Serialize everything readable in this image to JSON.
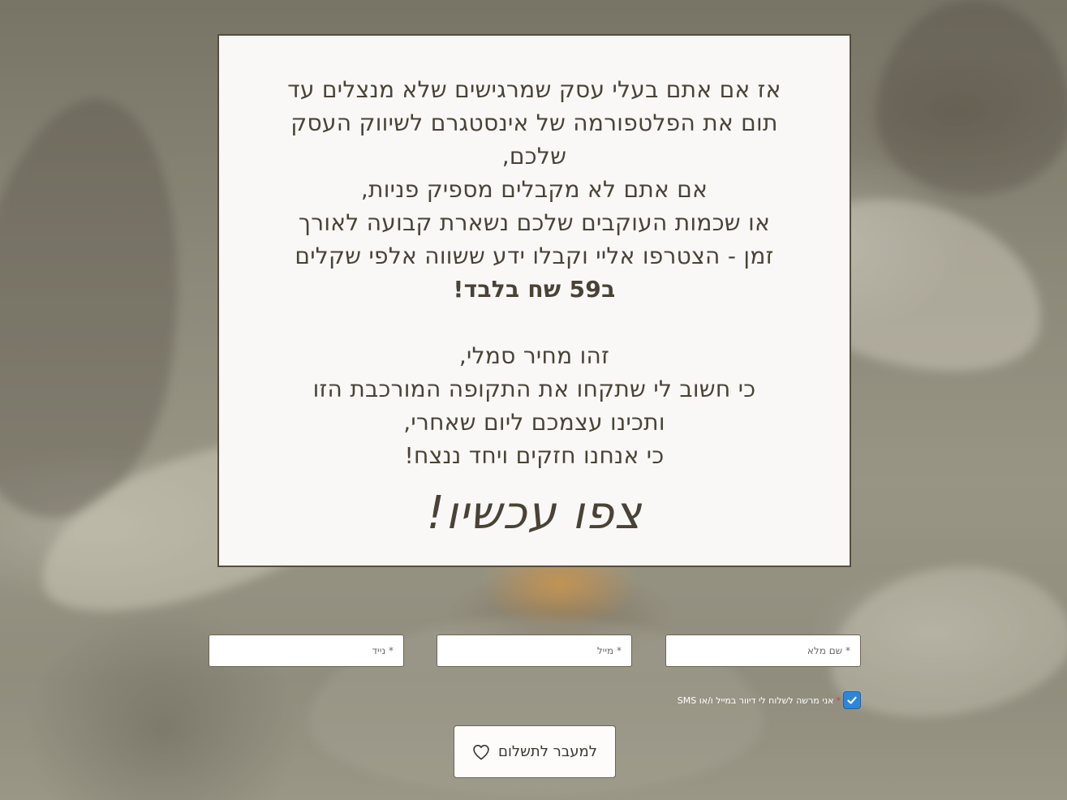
{
  "offer": {
    "paragraph_lines": [
      "אז אם אתם בעלי עסק שמרגישים שלא מנצלים עד",
      "תום את הפלטפורמה של אינסטגרם לשיווק העסק",
      "שלכם,",
      "אם אתם לא מקבלים מספיק פניות,",
      "או שכמות העוקבים שלכם נשארת קבועה לאורך",
      "זמן - הצטרפו אליי וקבלו ידע ששווה אלפי שקלים"
    ],
    "price": "ב59 שח בלבד!",
    "closing_lines": [
      "זהו מחיר סמלי,",
      "כי חשוב לי שתקחו את התקופה המורכבת הזו",
      "ותכינו עצמכם ליום שאחרי,",
      "כי אנחנו חזקים ויחד ננצח!"
    ],
    "cta_heading": "צפו עכשיו!"
  },
  "form": {
    "full_name_placeholder": "* שם מלא",
    "email_placeholder": "* מייל",
    "phone_placeholder": "* נייד",
    "consent_required_mark": "*",
    "consent_label": "אני מרשה לשלוח לי דיוור במייל ו/או SMS",
    "consent_checked": true,
    "submit_label": "למעבר לתשלום",
    "submit_icon": "heart-icon"
  },
  "colors": {
    "card_background": "#f9f8f6",
    "text": "#4a4236",
    "checkbox": "#2f86d8",
    "required": "#d23b2b"
  }
}
